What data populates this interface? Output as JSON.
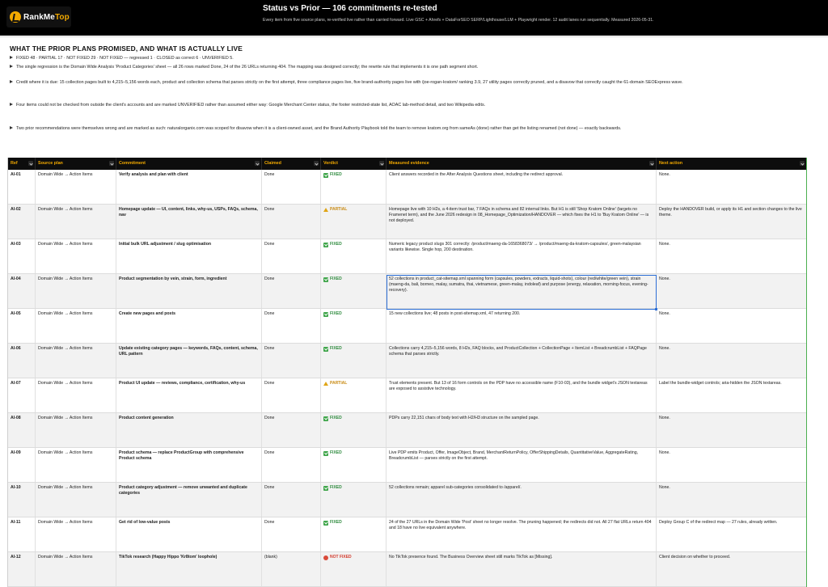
{
  "header": {
    "logo_text_a": "RankMe",
    "logo_text_b": "Top",
    "title": "Status vs Prior — 106 commitments re-tested",
    "subtitle": "Every item from five source plans, re-verified live rather than carried forward. Live GSC + Ahrefs + DataForSEO SERP/Lighthouse/LLM + Playwright render. 12 audit lanes run sequentially. Measured 2026-05-31."
  },
  "section": {
    "title": "WHAT THE PRIOR PLANS PROMISED, AND WHAT IS ACTUALLY LIVE",
    "bullets": [
      "FIXED 48 · PARTIAL 17 · NOT FIXED 29 · NOT FIXED — regressed 1 · CLOSED as correct 6 · UNVERIFIED 5.",
      "The single regression is the Domain Wide Analysis 'Product Categories' sheet — all 26 rows marked Done, 24 of the 26 URLs returning 404. The mapping was designed correctly; the rewrite rule that implements it is one path segment short.",
      "Credit where it is due: 15 collection pages built to 4,215–5,156 words each, product and collection schema that parses strictly on the first attempt, three compliance pages live, five brand-authority pages live with /joe-rogan-kratom/ ranking 3.9, 27 utility pages correctly pruned, and a disavow that correctly caught the 61-domain SEOExpress wave.",
      "Four items could not be checked from outside the client's accounts and are marked UNVERIFIED rather than assumed either way: Google Merchant Center status, the footer restricted-state list, AOAC lab-method detail, and two Wikipedia edits.",
      "Two prior recommendations were themselves wrong and are marked as such: naturalorganix.com was scoped for disavow when it is a client-owned asset, and the Brand Authority Playbook told the team to remove kratom.org from sameAs (done) rather than get the listing renamed (not done) — exactly backwards."
    ]
  },
  "table": {
    "columns": [
      "Ref",
      "Source plan",
      "Commitment",
      "Claimed",
      "Verdict",
      "Measured evidence",
      "Next action"
    ],
    "rows": [
      {
        "ref": "AI-01",
        "source": "Domain Wide → Action Items",
        "commitment": "Verify analysis and plan with client",
        "claimed": "Done",
        "verdict": "FIXED",
        "verdict_kind": "fixed",
        "evidence": "Client answers recorded in the After Analysis Questions sheet, including the redirect approval.",
        "next": "None."
      },
      {
        "ref": "AI-02",
        "source": "Domain Wide → Action Items",
        "commitment": "Homepage update — UI, content, links, why-us, USPs, FAQs, schema, nav",
        "claimed": "Done",
        "verdict": "PARTIAL",
        "verdict_kind": "partial",
        "evidence": "Homepage live with 10 H2s, a 4-item trust bar, 7 FAQs in schema and 82 internal links. But H1 is still 'Shop Kratom Online' (targets no Framenet term), and the June 2026 redesign in 08_Homepage_Optimization/HANDOVER — which fixes the H1 to 'Buy Kratom Online' — is not deployed.",
        "next": "Deploy the HANDOVER build, or apply its H1 and section changes to the live theme."
      },
      {
        "ref": "AI-03",
        "source": "Domain Wide → Action Items",
        "commitment": "Initial bulk URL adjustment / slug optimisation",
        "claimed": "Done",
        "verdict": "FIXED",
        "verdict_kind": "fixed",
        "evidence": "Numeric legacy product slugs 301 correctly: /product/maeng-da-1658368073/ → /product/maeng-da-kratom-capsules/, green-malaysian variants likewise. Single hop, 200 destination.",
        "next": "None."
      },
      {
        "ref": "AI-04",
        "source": "Domain Wide → Action Items",
        "commitment": "Product segmentation by vein, strain, form, ingredient",
        "claimed": "Done",
        "verdict": "FIXED",
        "verdict_kind": "fixed",
        "evidence": "52 collections in product_cat-sitemap.xml spanning form (capsules, powders, extracts, liquid-shots), colour (red/white/green vein), strain (maeng-da, bali, borneo, malay, sumatra, thai, vietnamese, green-malay, indoleaf) and purpose (energy, relaxation, morning-focus, evening-recovery).",
        "next": "None."
      },
      {
        "ref": "AI-05",
        "source": "Domain Wide → Action Items",
        "commitment": "Create new pages and posts",
        "claimed": "Done",
        "verdict": "FIXED",
        "verdict_kind": "fixed",
        "evidence": "15 new collections live; 48 posts in post-sitemap.xml, 47 returning 200.",
        "next": "None."
      },
      {
        "ref": "AI-06",
        "source": "Domain Wide → Action Items",
        "commitment": "Update existing category pages — keywords, FAQs, content, schema, URL pattern",
        "claimed": "Done",
        "verdict": "FIXED",
        "verdict_kind": "fixed",
        "evidence": "Collections carry 4,215–5,156 words, 8 H2s, FAQ blocks, and ProductCollection + CollectionPage + ItemList + BreadcrumbList + FAQPage schema that parses strictly.",
        "next": "None."
      },
      {
        "ref": "AI-07",
        "source": "Domain Wide → Action Items",
        "commitment": "Product UI update — reviews, compliance, certification, why-us",
        "claimed": "Done",
        "verdict": "PARTIAL",
        "verdict_kind": "partial",
        "evidence": "Trust elements present. But 13 of 16 form controls on the PDP have no accessible name (F10-03), and the bundle widget's JSON textareas are exposed to assistive technology.",
        "next": "Label the bundle-widget controls; aria-hidden the JSON textareas."
      },
      {
        "ref": "AI-08",
        "source": "Domain Wide → Action Items",
        "commitment": "Product content generation",
        "claimed": "Done",
        "verdict": "FIXED",
        "verdict_kind": "fixed",
        "evidence": "PDPs carry 22,151 chars of body text with H2/H3 structure on the sampled page.",
        "next": "None."
      },
      {
        "ref": "AI-09",
        "source": "Domain Wide → Action Items",
        "commitment": "Product schema — replace ProductGroup with comprehensive Product schema",
        "claimed": "Done",
        "verdict": "FIXED",
        "verdict_kind": "fixed",
        "evidence": "Live PDP emits Product, Offer, ImageObject, Brand, MerchantReturnPolicy, OfferShippingDetails, QuantitativeValue, AggregateRating, BreadcrumbList — parses strictly on the first attempt.",
        "next": "None."
      },
      {
        "ref": "AI-10",
        "source": "Domain Wide → Action Items",
        "commitment": "Product category adjustment — remove unwanted and duplicate categories",
        "claimed": "Done",
        "verdict": "FIXED",
        "verdict_kind": "fixed",
        "evidence": "52 collections remain; apparel sub-categories consolidated to /apparel/.",
        "next": "None."
      },
      {
        "ref": "AI-11",
        "source": "Domain Wide → Action Items",
        "commitment": "Get rid of low-value posts",
        "claimed": "Done",
        "verdict": "FIXED",
        "verdict_kind": "fixed",
        "evidence": "24 of the 27 URLs in the Domain Wide 'Post' sheet no longer resolve. The pruning happened; the redirects did not. All 27 flat URLs return 404 and 18 have no live equivalent anywhere.",
        "next": "Deploy Group C of the redirect map — 27 rules, already written."
      },
      {
        "ref": "AI-12",
        "source": "Domain Wide → Action Items",
        "commitment": "TikTok research (Happy Hippo 'Kr8tom' loophole)",
        "claimed": "(blank)",
        "verdict": "NOT FIXED",
        "verdict_kind": "notfixed",
        "evidence": "No TikTok presence found. The Business Overview sheet still marks TikTok as [Missing].",
        "next": "Client decision on whether to proceed."
      }
    ]
  }
}
